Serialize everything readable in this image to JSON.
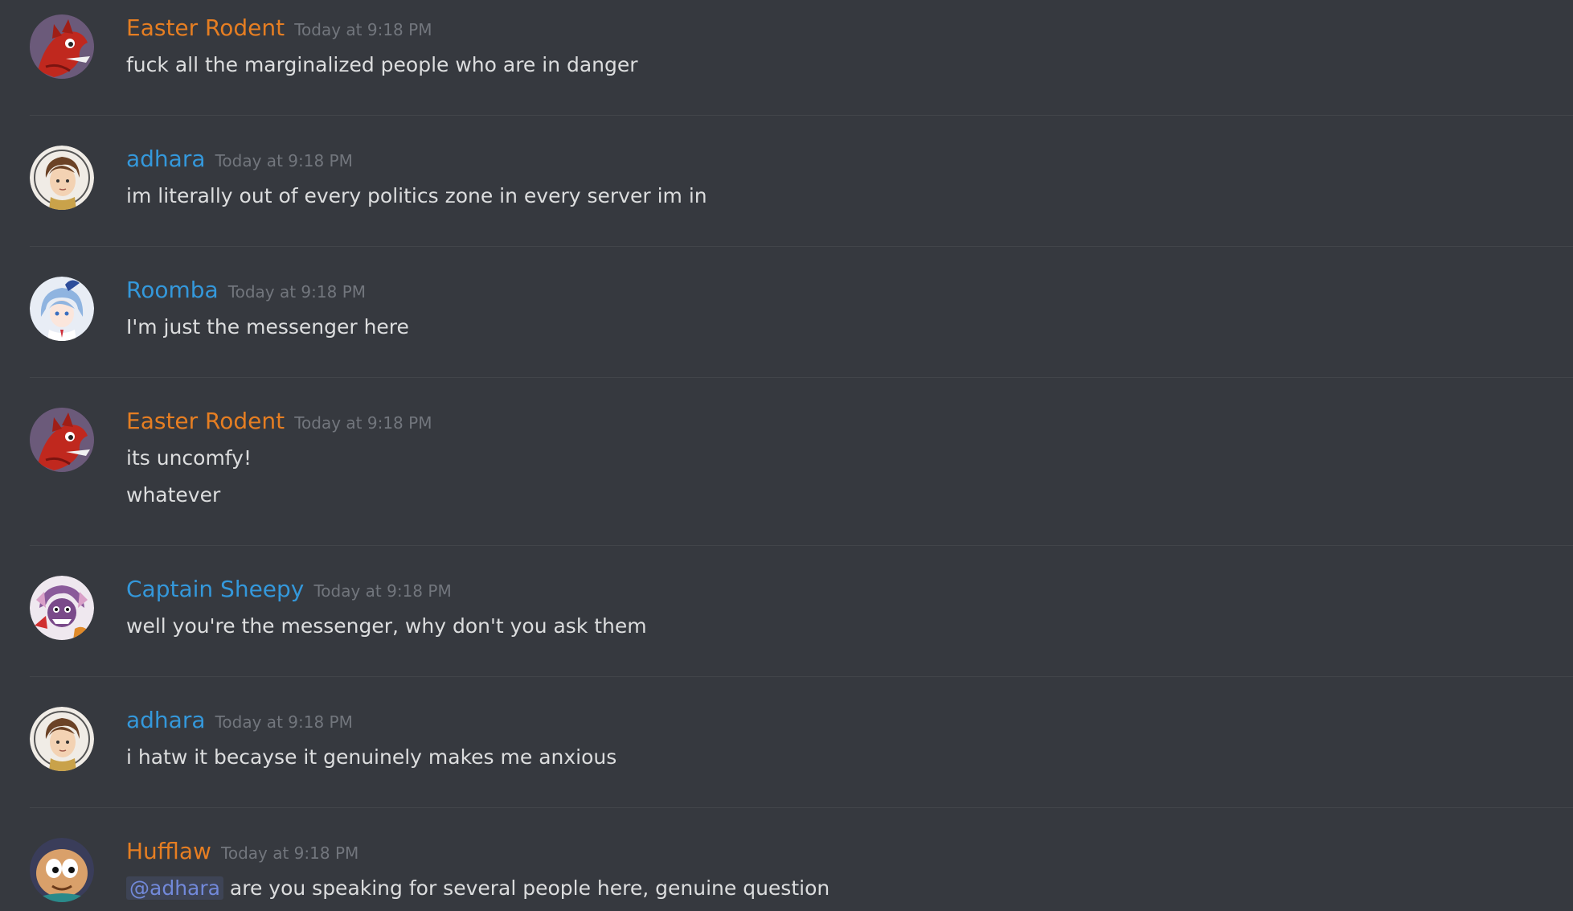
{
  "colors": {
    "background": "#36393f",
    "divider": "#42454a",
    "orange_role": "#e67e22",
    "blue_role": "#3498db",
    "timestamp": "#72767d",
    "text": "#dcddde",
    "mention": "#7289da"
  },
  "messages": [
    {
      "username": "Easter Rodent",
      "timestamp": "Today at 9:18 PM",
      "lines": [
        "fuck all the marginalized people who are in danger"
      ],
      "avatar_icon": "red-dragon-avatar"
    },
    {
      "username": "adhara",
      "timestamp": "Today at 9:18 PM",
      "lines": [
        "im literally out of every politics zone in every server im in"
      ],
      "avatar_icon": "brown-hair-character-avatar"
    },
    {
      "username": "Roomba",
      "timestamp": "Today at 9:18 PM",
      "lines": [
        "I'm just the messenger here"
      ],
      "avatar_icon": "blue-hair-anime-girl-avatar"
    },
    {
      "username": "Easter Rodent",
      "timestamp": "Today at 9:18 PM",
      "lines": [
        "its uncomfy!",
        "whatever"
      ],
      "avatar_icon": "red-dragon-avatar"
    },
    {
      "username": "Captain Sheepy",
      "timestamp": "Today at 9:18 PM",
      "lines": [
        "well you're the messenger, why don't you ask them"
      ],
      "avatar_icon": "purple-character-avatar"
    },
    {
      "username": "adhara",
      "timestamp": "Today at 9:18 PM",
      "lines": [
        "i hatw it becayse it genuinely makes me anxious"
      ],
      "avatar_icon": "brown-hair-character-avatar"
    },
    {
      "username": "Hufflaw",
      "timestamp": "Today at 9:18 PM",
      "mention": "@adhara",
      "lines": [
        "are you speaking for several people here, genuine question"
      ],
      "avatar_icon": "cartoon-face-avatar"
    }
  ]
}
